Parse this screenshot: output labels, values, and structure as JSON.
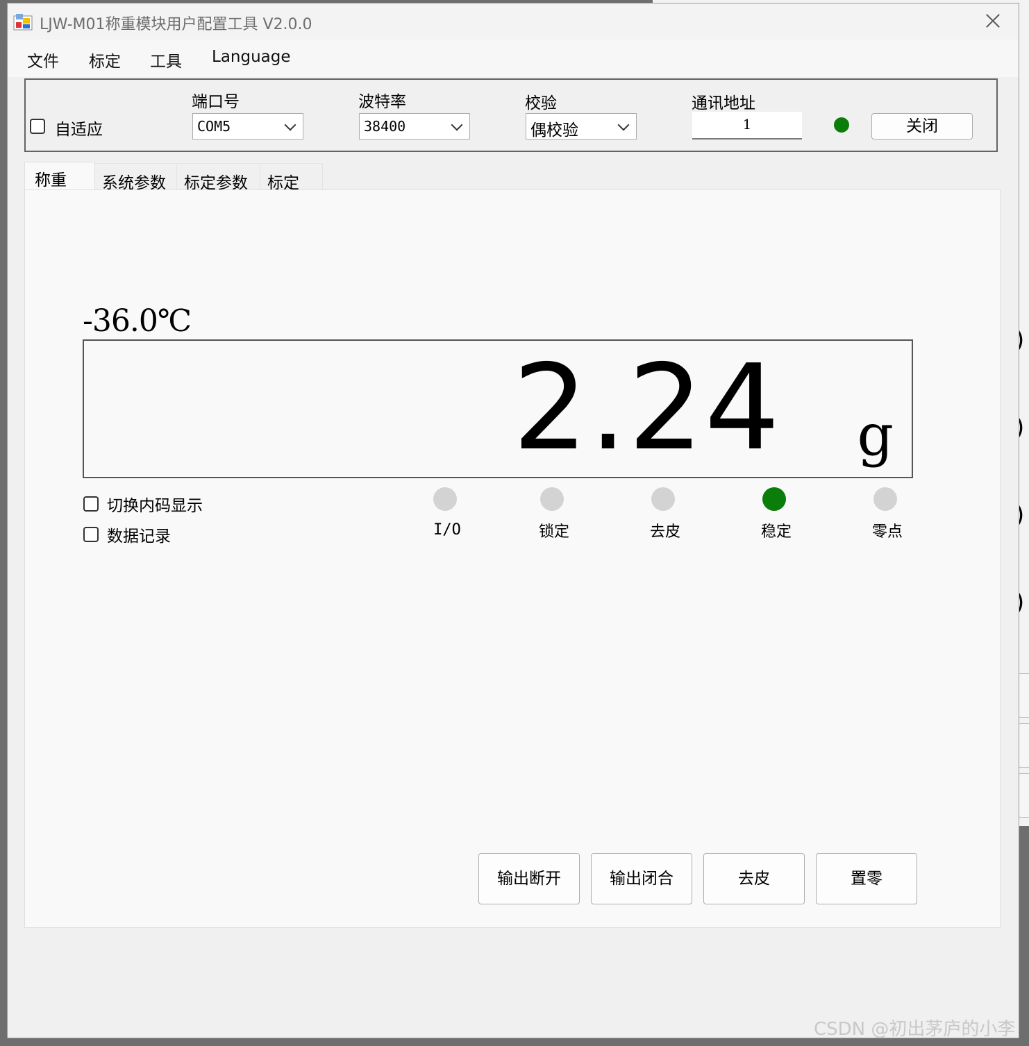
{
  "window": {
    "title": "LJW-M01称重模块用户配置工具 V2.0.0"
  },
  "menu": [
    "文件",
    "标定",
    "工具",
    "Language"
  ],
  "connection": {
    "auto_adapt_label": "自适应",
    "auto_adapt_checked": false,
    "port": {
      "label": "端口号",
      "value": "COM5"
    },
    "baud": {
      "label": "波特率",
      "value": "38400"
    },
    "parity": {
      "label": "校验",
      "value": "偶校验"
    },
    "address": {
      "label": "通讯地址",
      "value": "1"
    },
    "status_color": "#0a7d0a",
    "close_button": "关闭"
  },
  "tabs": [
    "称重",
    "系统参数",
    "标定参数",
    "标定"
  ],
  "active_tab": "称重",
  "weighing": {
    "temperature": "-36.0℃",
    "weight": "2.24",
    "unit": "g",
    "options": [
      {
        "label": "切换内码显示",
        "checked": false
      },
      {
        "label": "数据记录",
        "checked": false
      }
    ],
    "indicators": [
      {
        "label": "I/O",
        "on": false
      },
      {
        "label": "锁定",
        "on": false
      },
      {
        "label": "去皮",
        "on": false
      },
      {
        "label": "稳定",
        "on": true
      },
      {
        "label": "零点",
        "on": false
      }
    ],
    "actions": [
      "输出断开",
      "输出闭合",
      "去皮",
      "置零"
    ]
  },
  "watermark": "CSDN @初出茅庐的小李"
}
